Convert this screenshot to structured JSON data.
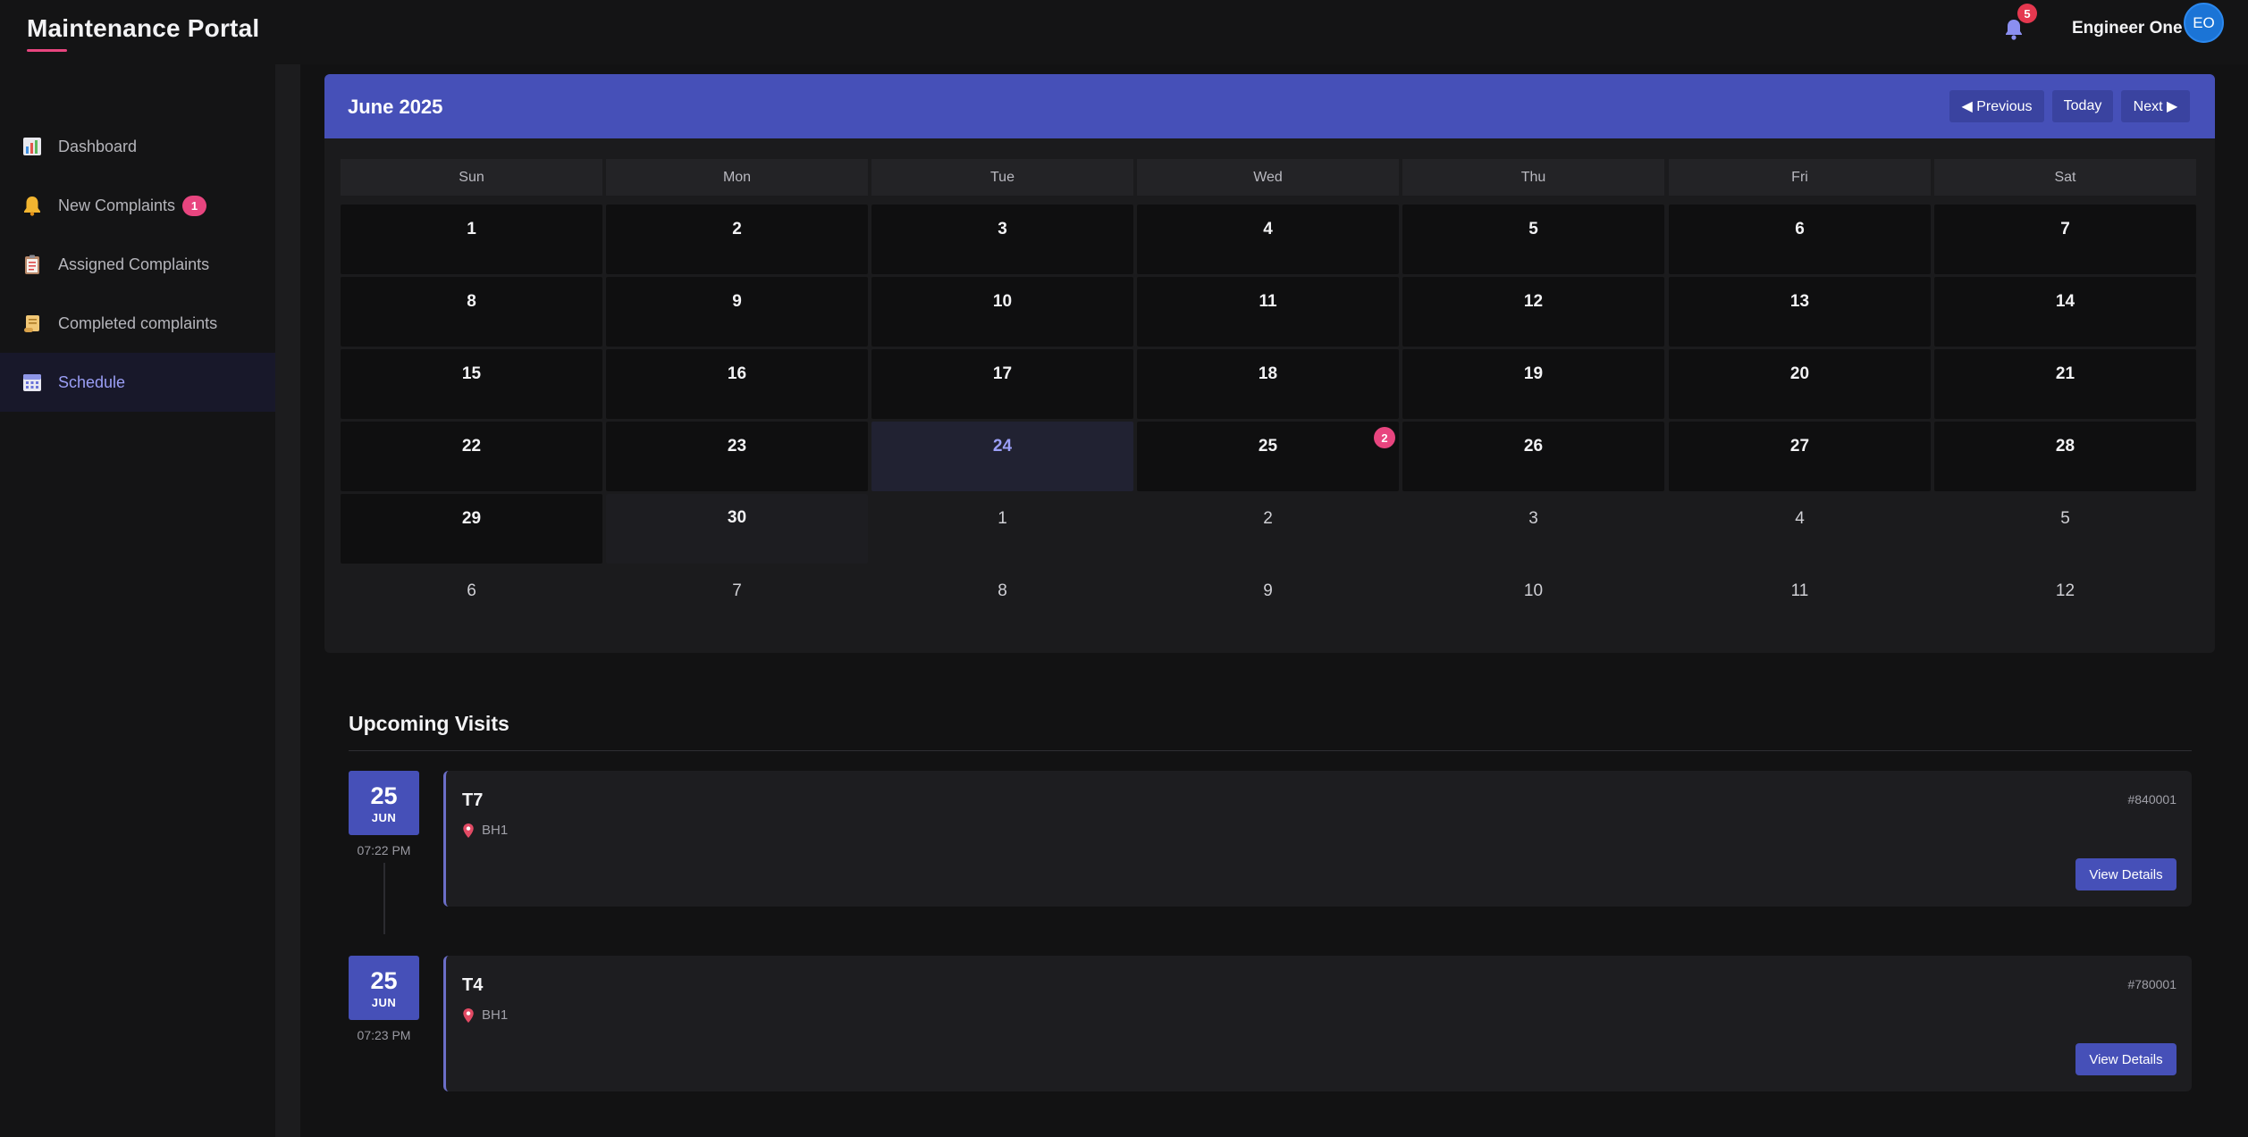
{
  "header": {
    "brand": "Maintenance Portal",
    "notification_count": "5",
    "user_name": "Engineer One",
    "avatar_initials": "EO",
    "accent_color": "#e8457f"
  },
  "sidebar": {
    "items": [
      {
        "label": "Dashboard",
        "icon": "bar-chart-icon",
        "active": false
      },
      {
        "label": "New Complaints",
        "icon": "bell-icon",
        "badge": "1",
        "active": false
      },
      {
        "label": "Assigned Complaints",
        "icon": "clipboard-icon",
        "active": false
      },
      {
        "label": "Completed complaints",
        "icon": "scroll-icon",
        "active": false
      },
      {
        "label": "Schedule",
        "icon": "calendar-icon",
        "active": true
      }
    ]
  },
  "calendar": {
    "title": "June 2025",
    "prev_label": "◀ Previous",
    "today_label": "Today",
    "next_label": "Next ▶",
    "weekdays": [
      "Sun",
      "Mon",
      "Tue",
      "Wed",
      "Thu",
      "Fri",
      "Sat"
    ],
    "weeks": [
      [
        "1",
        "2",
        "3",
        "4",
        "5",
        "6",
        "7"
      ],
      [
        "8",
        "9",
        "10",
        "11",
        "12",
        "13",
        "14"
      ],
      [
        "15",
        "16",
        "17",
        "18",
        "19",
        "20",
        "21"
      ],
      [
        "22",
        "23",
        "24",
        "25",
        "26",
        "27",
        "28"
      ],
      [
        "29",
        "30",
        "1",
        "2",
        "3",
        "4",
        "5"
      ],
      [
        "6",
        "7",
        "8",
        "9",
        "10",
        "11",
        "12"
      ]
    ],
    "today": "24",
    "event_day": "25",
    "event_count": "2"
  },
  "upcoming": {
    "title": "Upcoming Visits",
    "visits": [
      {
        "day": "25",
        "month": "JUN",
        "time": "07:22 PM",
        "name": "T7",
        "location": "BH1",
        "id": "#840001",
        "button": "View Details"
      },
      {
        "day": "25",
        "month": "JUN",
        "time": "07:23 PM",
        "name": "T4",
        "location": "BH1",
        "id": "#780001",
        "button": "View Details"
      }
    ]
  }
}
